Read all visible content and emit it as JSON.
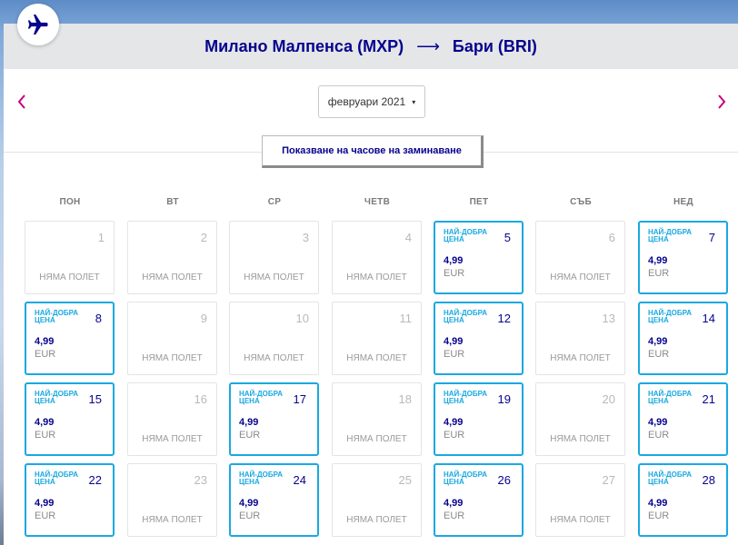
{
  "header": {
    "origin": "Милано Малпенса (MXP)",
    "arrow": "⟶",
    "destination": "Бари (BRI)"
  },
  "icons": {
    "plane": "airplane-icon",
    "prev": "chevron-left-icon",
    "next": "chevron-right-icon",
    "caret": "caret-down-icon"
  },
  "colors": {
    "brand": "#06038d",
    "best_price_border": "#19a9e0",
    "nav_arrow": "#c6007e"
  },
  "month_select": {
    "value": "февруари 2021",
    "caret": "▾"
  },
  "departure_times_button": "Показване на часове на заминаване",
  "weekdays": [
    "ПОН",
    "ВТ",
    "СР",
    "ЧЕТВ",
    "ПЕТ",
    "СЪБ",
    "НЕД"
  ],
  "labels": {
    "no_flight": "НЯМА ПОЛЕТ",
    "best_price": "НАЙ-ДОБРА ЦЕНА"
  },
  "days": [
    {
      "day": "1",
      "best": false
    },
    {
      "day": "2",
      "best": false
    },
    {
      "day": "3",
      "best": false
    },
    {
      "day": "4",
      "best": false
    },
    {
      "day": "5",
      "best": true,
      "price": "4,99",
      "currency": "EUR"
    },
    {
      "day": "6",
      "best": false
    },
    {
      "day": "7",
      "best": true,
      "price": "4,99",
      "currency": "EUR"
    },
    {
      "day": "8",
      "best": true,
      "price": "4,99",
      "currency": "EUR"
    },
    {
      "day": "9",
      "best": false
    },
    {
      "day": "10",
      "best": false
    },
    {
      "day": "11",
      "best": false
    },
    {
      "day": "12",
      "best": true,
      "price": "4,99",
      "currency": "EUR"
    },
    {
      "day": "13",
      "best": false
    },
    {
      "day": "14",
      "best": true,
      "price": "4,99",
      "currency": "EUR"
    },
    {
      "day": "15",
      "best": true,
      "price": "4,99",
      "currency": "EUR"
    },
    {
      "day": "16",
      "best": false
    },
    {
      "day": "17",
      "best": true,
      "price": "4,99",
      "currency": "EUR"
    },
    {
      "day": "18",
      "best": false
    },
    {
      "day": "19",
      "best": true,
      "price": "4,99",
      "currency": "EUR"
    },
    {
      "day": "20",
      "best": false
    },
    {
      "day": "21",
      "best": true,
      "price": "4,99",
      "currency": "EUR"
    },
    {
      "day": "22",
      "best": true,
      "price": "4,99",
      "currency": "EUR"
    },
    {
      "day": "23",
      "best": false
    },
    {
      "day": "24",
      "best": true,
      "price": "4,99",
      "currency": "EUR"
    },
    {
      "day": "25",
      "best": false
    },
    {
      "day": "26",
      "best": true,
      "price": "4,99",
      "currency": "EUR"
    },
    {
      "day": "27",
      "best": false
    },
    {
      "day": "28",
      "best": true,
      "price": "4,99",
      "currency": "EUR"
    }
  ]
}
